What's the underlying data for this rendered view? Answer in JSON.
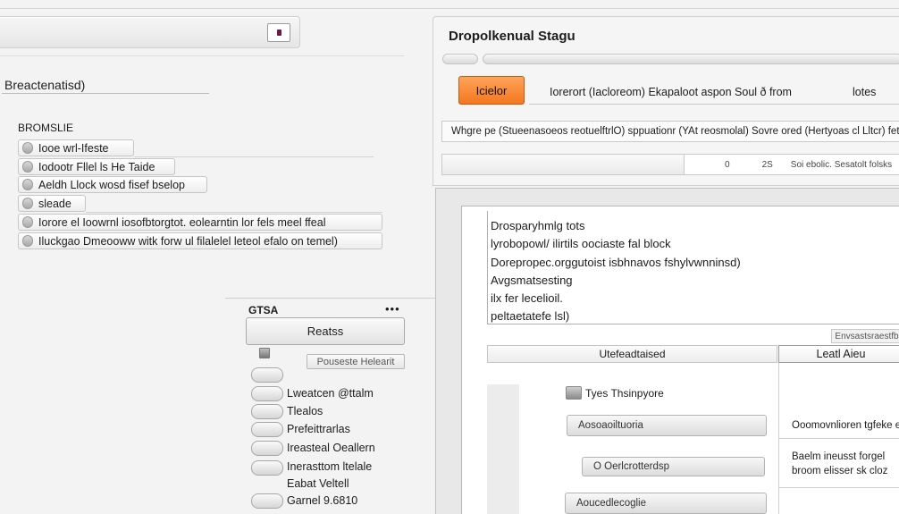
{
  "left": {
    "topbar_button": "",
    "section_title": "Breactenatisd)",
    "group_label": "BROMSLIE",
    "list_items": [
      {
        "label": "Iooe wrl-Ifeste"
      },
      {
        "label": "Iodootr Fllel ls He Taide"
      },
      {
        "label": "Aeldh Llock wosd fisef bselop"
      },
      {
        "label": "sleade"
      },
      {
        "label": "Iorore el Ioowrnl iosofbtorgtot. eolearntin lor fels meel   ffeal"
      },
      {
        "label": "Iluckgao Dmeooww witk forw ul filalelel leteol efalo on temel)"
      }
    ]
  },
  "settings": {
    "title": "GTSA",
    "menu_dots": "•••",
    "reset_label": "Reatss",
    "preset_label": "Pouseste Helearit",
    "options": [
      {
        "label": ""
      },
      {
        "label": "Lweatcen @ttalm"
      },
      {
        "label": "Tlealos"
      },
      {
        "label": "Prefeittrarlas"
      },
      {
        "label": "Ireasteal Oeallern"
      },
      {
        "label": "Inerasttom ltelale"
      },
      {
        "label": "Eabat Veltell"
      },
      {
        "label": "Garnel 9.6810"
      }
    ]
  },
  "right": {
    "title": "Dropolkenual Stagu",
    "primary_button": "Icielor",
    "toolbar_text": "Iorerort  (Iacloreom)   Ekapaloot  aspon  Soul ð from",
    "toolbar_text2": "lotes",
    "description": "Whgre pe (Stueenasoeos reotuelftrlO) sppuationr (YAt reosmolal) Sovre ored (Hertyoas cl Lltcr) fetoe ble feleq ooss by Oe blocmp",
    "status": {
      "col1": "0",
      "col2": "2S",
      "col3": "Soi ebolic. Sesatolt  folsks"
    }
  },
  "content": {
    "text_lines": [
      "Drosparyhmlg tots",
      "lyrobopowl/ ilirtils oociaste fal block",
      "Dorepropec.orggutoist  isbhnavos fshylvwnninsd)",
      "Avgsmatsesting",
      "ilx fer lecelioil.",
      "peltaetatefe lsl)"
    ],
    "table_hint": "Envsastsraestfb",
    "col_head_1": "Utefeadtaised",
    "col_head_2": "Leatl Aieu",
    "rows": [
      {
        "chip": "Tyes Thsinpyore"
      },
      {
        "dropdown": "Aosoaoiltuoria"
      },
      {
        "dropdown": "O Oerlcrotterdsp"
      },
      {
        "dropdown": "Aoucedlecoglie"
      }
    ],
    "side_text_1": "Ooomovnlioren tgfeke es",
    "side_text_2a": "Baelm ineusst forgel",
    "side_text_2b": "broom elisser sk cloz"
  },
  "colors": {
    "accent": "#f3771f",
    "background": "#f3f3f3"
  }
}
